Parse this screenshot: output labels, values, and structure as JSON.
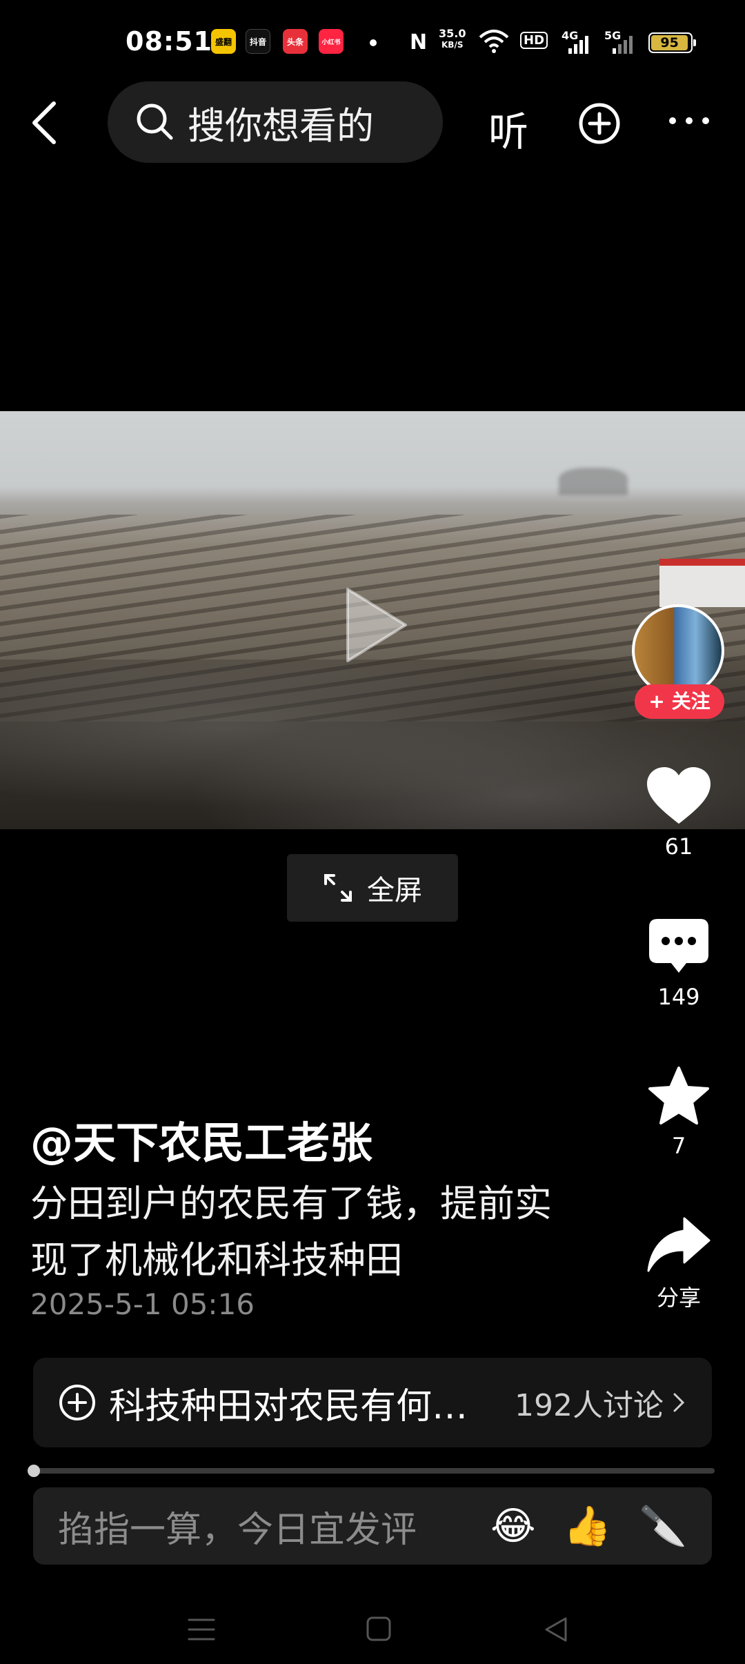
{
  "status": {
    "time": "08:51",
    "apps": [
      {
        "name": "app-badge-1",
        "label": "盛翻",
        "color": "#f5c400"
      },
      {
        "name": "app-badge-2",
        "label": "抖音",
        "color": "#111111"
      },
      {
        "name": "app-badge-3",
        "label": "头条",
        "color": "#e8303a"
      },
      {
        "name": "app-badge-4",
        "label": "小红书",
        "color": "#ff2442"
      }
    ],
    "net_speed_value": "35.0",
    "net_speed_unit": "KB/S",
    "hd": "HD",
    "sig1": "4G",
    "sig2": "5G",
    "battery": "95"
  },
  "topbar": {
    "search_placeholder": "搜你想看的",
    "listen_label": "听"
  },
  "video": {
    "fullscreen_label": "全屏"
  },
  "actions": {
    "follow_label": "+ 关注",
    "likes": "61",
    "comments": "149",
    "favorites": "7",
    "share_label": "分享"
  },
  "post": {
    "author": "@天下农民工老张",
    "description": "分田到户的农民有了钱，提前实现了机械化和科技种田",
    "date": "2025-5-1 05:16"
  },
  "topic": {
    "title": "科技种田对农民有何…",
    "count": "192人讨论"
  },
  "comment": {
    "placeholder": "掐指一算，今日宜发评",
    "emojis": [
      "😂",
      "👍",
      "🔪"
    ]
  },
  "colors": {
    "accent": "#f2364a",
    "battery": "#d7b740"
  }
}
